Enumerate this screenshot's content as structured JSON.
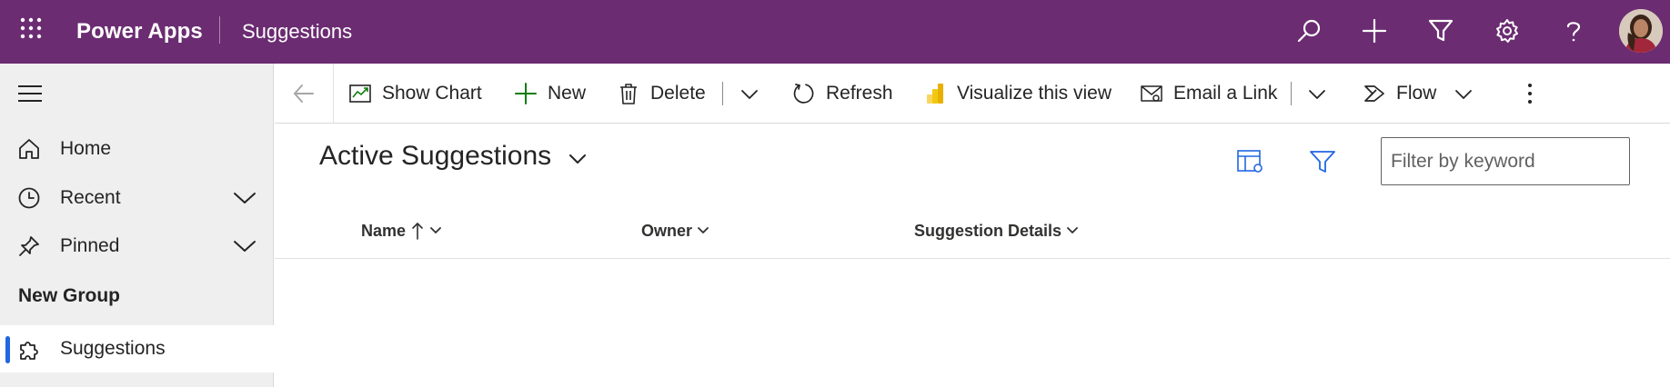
{
  "header": {
    "app_name": "Power Apps",
    "page": "Suggestions",
    "brand_color": "#6b2c72",
    "icons": [
      "waffle-icon",
      "search-icon",
      "add-icon",
      "filter-icon",
      "settings-icon",
      "help-icon",
      "avatar"
    ]
  },
  "sidebar": {
    "items": [
      {
        "label": "Home",
        "icon": "home-icon"
      },
      {
        "label": "Recent",
        "icon": "clock-icon",
        "expandable": true
      },
      {
        "label": "Pinned",
        "icon": "pin-icon",
        "expandable": true
      }
    ],
    "group_label": "New Group",
    "group_items": [
      {
        "label": "Suggestions",
        "icon": "puzzle-icon",
        "active": true
      }
    ],
    "active_indicator_color": "#2266e3"
  },
  "commandbar": {
    "show_chart": "Show Chart",
    "new": "New",
    "delete": "Delete",
    "refresh": "Refresh",
    "visualize": "Visualize this view",
    "email_link": "Email a Link",
    "flow": "Flow"
  },
  "view": {
    "title": "Active Suggestions",
    "search_placeholder": "Filter by keyword",
    "search_value": "",
    "columns": [
      {
        "label": "Name",
        "sort": "ascending"
      },
      {
        "label": "Owner"
      },
      {
        "label": "Suggestion Details"
      }
    ],
    "rows": []
  }
}
